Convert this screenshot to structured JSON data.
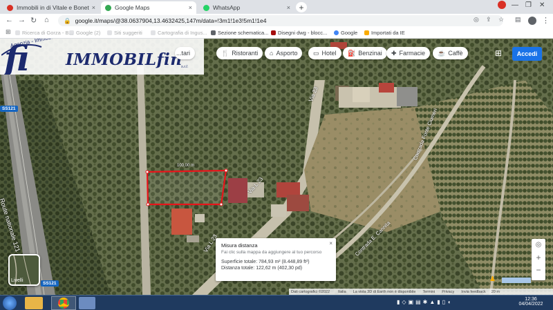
{
  "browser": {
    "tabs": [
      {
        "title": "Immobili in di Vitale e Bonetti s.r.",
        "active": false,
        "favicon_color": "#d93025"
      },
      {
        "title": "Google Maps",
        "active": true,
        "favicon_color": "#34a853"
      },
      {
        "title": "WhatsApp",
        "active": false,
        "favicon_color": "#25d366"
      }
    ],
    "new_tab": "+",
    "url": "google.it/maps/@38.0637904,13.4632425,147m/data=!3m1!1e3!5m1!1e4",
    "bookmarks": [
      {
        "label": "Ricerca di Gorza - B...",
        "color": "#bdc1c6"
      },
      {
        "label": "Google (2)",
        "color": "#bdc1c6"
      },
      {
        "label": "Siti suggeriti",
        "color": "#bdc1c6"
      },
      {
        "label": "Cartografia di Ingus...",
        "color": "#bdc1c6"
      },
      {
        "label": "Sezione schematica...",
        "color": "#5f6368"
      },
      {
        "label": "Disegni dwg - blocc...",
        "color": "#a50e0e"
      },
      {
        "label": "Google",
        "color": "#4285f4"
      },
      {
        "label": "Importati da IE",
        "color": "#f9ab00"
      }
    ]
  },
  "logo": {
    "brand": "IMMOBILfin",
    "suffix": "s.r.l.",
    "tagline": "Agenzia - Immobiliare"
  },
  "maps": {
    "chips": [
      {
        "label": "Ristoranti",
        "icon": "fork-knife-icon",
        "glyph": "🍴"
      },
      {
        "label": "Asporto",
        "icon": "takeaway-icon",
        "glyph": "⌂"
      },
      {
        "label": "Hotel",
        "icon": "bed-icon",
        "glyph": "▭"
      },
      {
        "label": "Benzinai",
        "icon": "gas-station-icon",
        "glyph": "⛽"
      },
      {
        "label": "Farmacie",
        "icon": "pharmacy-icon",
        "glyph": "✚"
      },
      {
        "label": "Caffè",
        "icon": "coffee-icon",
        "glyph": "☕"
      }
    ],
    "partial_chip": "...tari",
    "sign_in": "Accedi",
    "road_labels": {
      "road_ss121": "SS121",
      "route_nationale": "Route nationale 121",
      "via_a": "Via 23",
      "via_b": "Via L 23",
      "via_c": "Via L 23",
      "contrada": "Contrada Fonte Ciumeri",
      "contrada2": "Contrada E. Cannita"
    },
    "measure_segment_label": "100,00 m",
    "measure_panel": {
      "title": "Misura distanza",
      "hint": "Fai clic sulla mappa da aggiungere al tuo percorso",
      "area": "Superficie totale: 784,93 m² (8.448,89 ft²)",
      "distance": "Distanza totale: 122,62 m (402,30 pd)"
    },
    "layers_label": "Livelli",
    "footer": {
      "copyright": "Dati cartografici ©2022",
      "country": "Italia",
      "note": "La vista 3D di Earth non è disponibile",
      "terms": "Termini",
      "privacy": "Privacy",
      "feedback": "Invia feedback",
      "scale": "20 m"
    }
  },
  "taskbar": {
    "time": "12:36",
    "date": "04/04/2022"
  },
  "colors": {
    "accent": "#1a73e8",
    "measure_line": "#e8141a",
    "taskbar": "#1f3a5f"
  }
}
